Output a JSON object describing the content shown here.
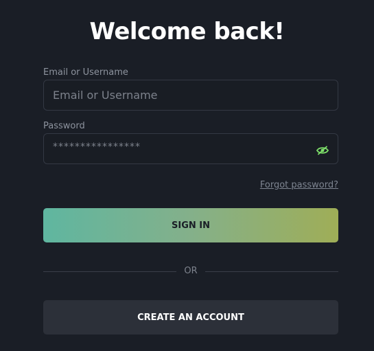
{
  "title": "Welcome back!",
  "email": {
    "label": "Email or Username",
    "placeholder": "Email or Username",
    "value": ""
  },
  "password": {
    "label": "Password",
    "masked_value": "****************",
    "toggle_icon": "eye-slash-icon"
  },
  "forgot_password": "Forgot password?",
  "sign_in": "SIGN IN",
  "divider": "OR",
  "create_account": "CREATE AN ACCOUNT",
  "colors": {
    "background": "#1a1e26",
    "gradient_start": "#5fb6a0",
    "gradient_end": "#9fae57",
    "secondary_button": "#2c3039",
    "eye_icon": "#7ee06a"
  }
}
